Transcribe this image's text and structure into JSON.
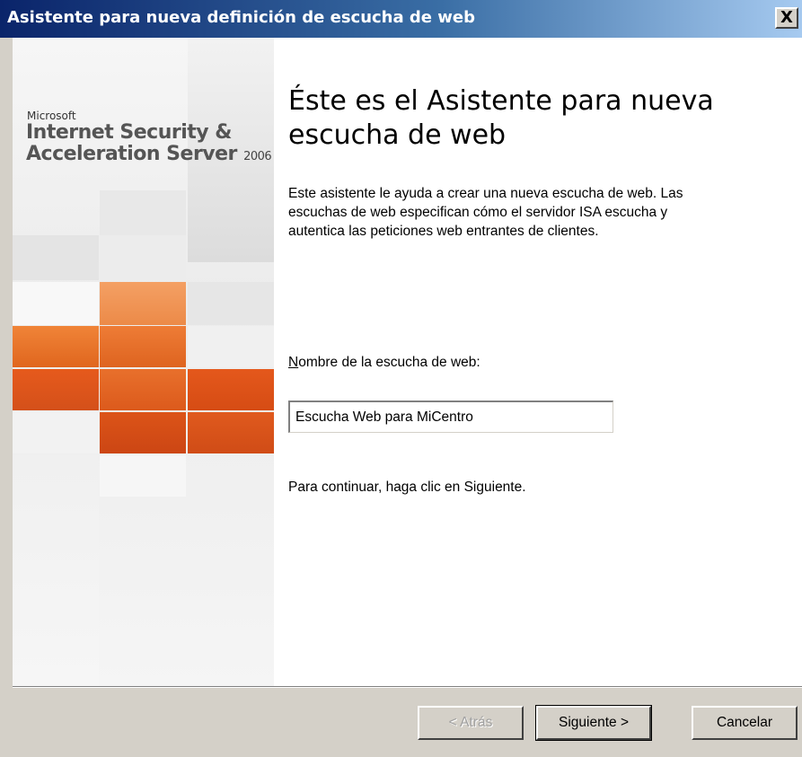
{
  "window": {
    "title": "Asistente para nueva definición de escucha de web",
    "close_glyph": "X"
  },
  "sidebar": {
    "brand_company": "Microsoft",
    "brand_product": "Internet Security & Acceleration Server",
    "brand_year": "2006",
    "accent_colors": [
      "#f08a3c",
      "#e2622a",
      "#d9501e",
      "#eeeeee"
    ]
  },
  "content": {
    "heading": "Éste es el Asistente para nueva escucha de web",
    "description": "Este asistente le ayuda a crear una nueva escucha de web. Las escuchas de web especifican cómo el servidor ISA escucha y autentica las peticiones web entrantes de clientes.",
    "name_label_mnemonic": "N",
    "name_label_rest": "ombre de la escucha de web:",
    "name_value": "Escucha Web para MiCentro",
    "continue_text": "Para continuar, haga clic en Siguiente."
  },
  "buttons": {
    "back": "< Atrás",
    "next": "Siguiente >",
    "cancel": "Cancelar"
  }
}
